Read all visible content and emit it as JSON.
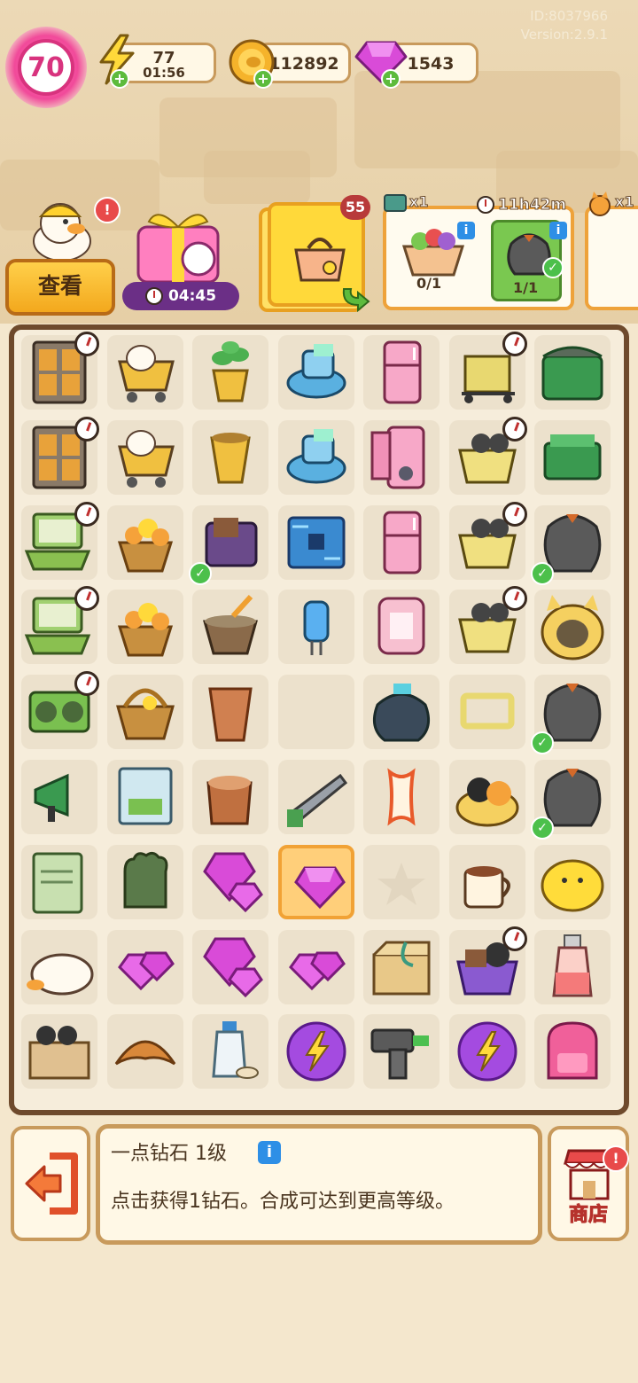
{
  "header": {
    "id_text": "ID:8037966",
    "version_text": "Version:2.9.1",
    "level": "70",
    "energy": "77",
    "energy_timer": "01:56",
    "coins": "112892",
    "gems": "1543"
  },
  "left_panel": {
    "inspect_label": "查看",
    "gift_timer": "04:45"
  },
  "orders": {
    "stack_count": "55",
    "card1_tag": "x1",
    "card1_progress": "0/1",
    "card2_timer": "11h42m",
    "card2_progress": "1/1",
    "card3_tag": "x1"
  },
  "board": {
    "rows": [
      [
        "locker",
        "duck-cart",
        "plant-pot",
        "robot-vacuum",
        "pink-fridge",
        "cart-box",
        "green-chest"
      ],
      [
        "locker",
        "duck-cart",
        "empty-pot",
        "robot-vacuum",
        "open-fridge",
        "basket-weights",
        "toolbox"
      ],
      [
        "laptop",
        "flower-basket",
        "purple-bag",
        "circuit-board",
        "pink-fridge-closed",
        "basket-handle",
        "gray-sack"
      ],
      [
        "laptop",
        "flower-basket",
        "mortar-brush",
        "capacitor",
        "pink-case",
        "basket-dumbbell",
        "cat-bed"
      ],
      [
        "radio",
        "wicker-basket",
        "clay-pot",
        "empty",
        "ink-bag",
        "cable-frame",
        "gray-sack"
      ],
      [
        "megaphone",
        "duck-book",
        "tree-stump",
        "hand-saw",
        "apple-core",
        "cat-basket",
        "gray-sack"
      ],
      [
        "manual",
        "work-glove",
        "gem-cluster",
        "selected-gem",
        "star-slot",
        "cocoa-mug",
        "yellow-chick"
      ],
      [
        "sleeping-duck",
        "gem-small",
        "gem-cluster",
        "gem-small",
        "rope-box",
        "purple-basket",
        "potion-bottle"
      ],
      [
        "dumbbell-box",
        "croissant",
        "milk-bottle",
        "energy-orb",
        "power-drill",
        "energy-orb",
        "pink-backpack"
      ]
    ]
  },
  "info": {
    "title": "一点钻石 1级",
    "description": "点击获得1钻石。合成可达到更高等级。"
  },
  "shop": {
    "label": "商店",
    "alert": "!"
  },
  "colors": {
    "accent_orange": "#eea23a",
    "board_border": "#6e4a2c",
    "gem_purple": "#d94bd8",
    "energy_purple": "#a44be0",
    "check_green": "#4cc04b"
  }
}
